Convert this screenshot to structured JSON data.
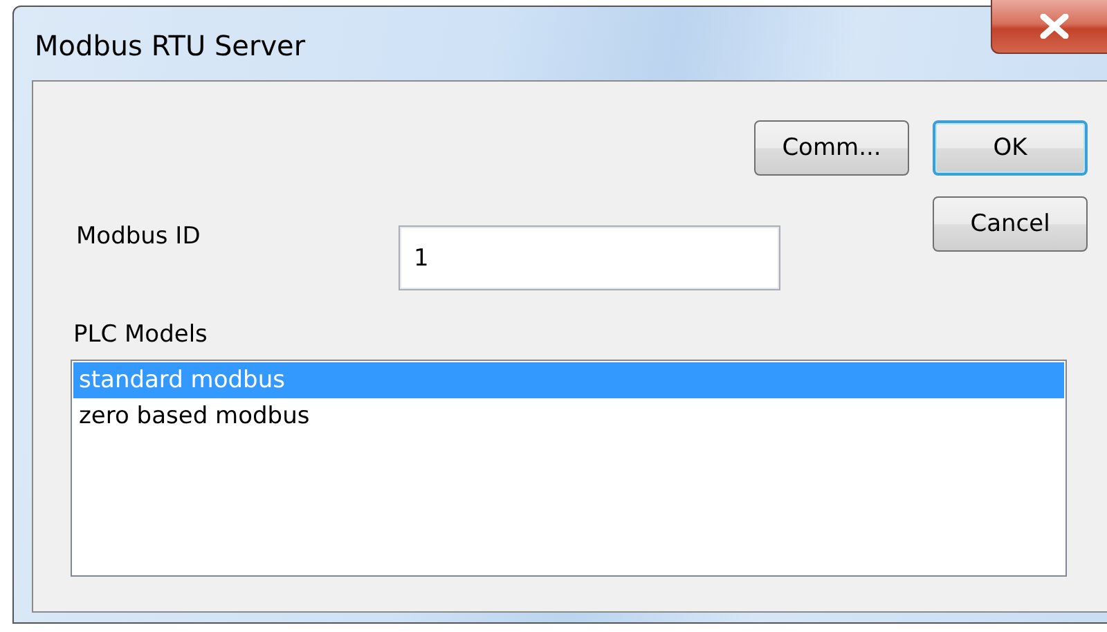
{
  "window": {
    "title": "Modbus RTU Server"
  },
  "buttons": [
    {
      "label": "Comm...",
      "default": false
    },
    {
      "label": "OK",
      "default": true
    },
    {
      "label": "Cancel",
      "default": false
    }
  ],
  "modbus_id": {
    "label": "Modbus ID",
    "value": "1"
  },
  "plc_models": {
    "label": "PLC Models",
    "items": [
      {
        "label": "standard modbus",
        "selected": true
      },
      {
        "label": "zero based modbus",
        "selected": false
      }
    ]
  }
}
